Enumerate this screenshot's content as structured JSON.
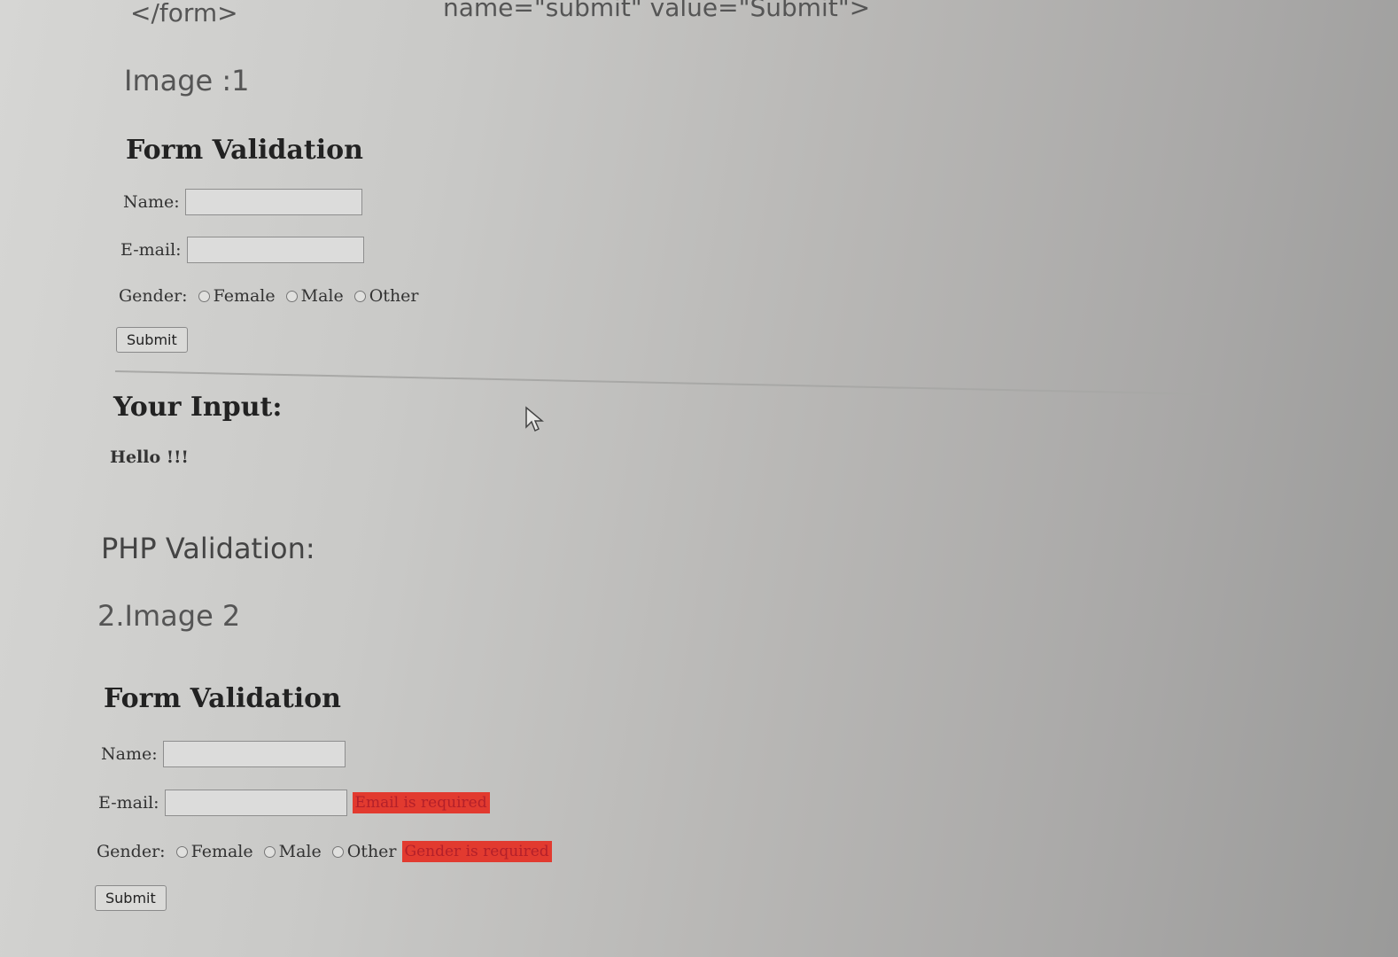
{
  "code": {
    "closing_tag": "</form>",
    "partial_line": "name=\"submit\" value=\"Submit\">"
  },
  "image1": {
    "caption": "Image :1",
    "title": "Form Validation",
    "name_label": "Name:",
    "email_label": "E-mail:",
    "gender_label": "Gender:",
    "gender_options": [
      "Female",
      "Male",
      "Other"
    ],
    "submit_label": "Submit",
    "your_input_heading": "Your Input:",
    "your_input_text": "Hello !!!"
  },
  "section": {
    "php_heading": "PHP Validation:",
    "image2_caption": "2.Image 2"
  },
  "image2": {
    "title": "Form Validation",
    "name_label": "Name:",
    "email_label": "E-mail:",
    "email_error": "Email is required",
    "gender_label": "Gender:",
    "gender_options": [
      "Female",
      "Male",
      "Other"
    ],
    "gender_error": "Gender is required",
    "submit_label": "Submit"
  },
  "colors": {
    "error_bg": "#e23a2f",
    "error_text": "#b3202a"
  },
  "icons": {
    "cursor": "mouse-pointer-icon"
  }
}
